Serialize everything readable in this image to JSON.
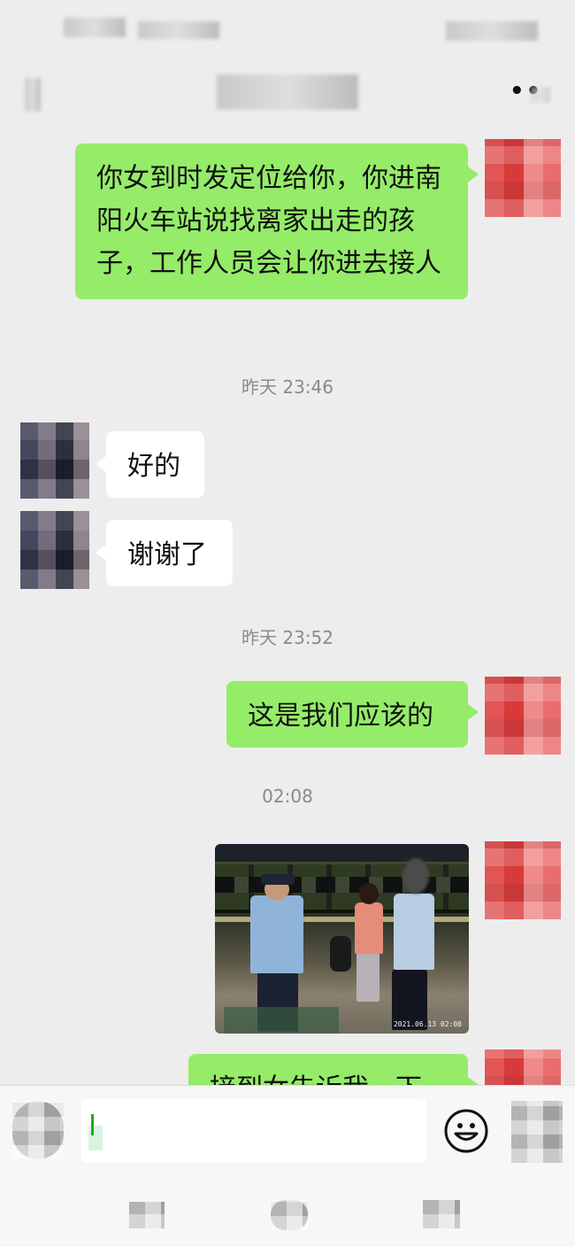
{
  "chat": {
    "messages": [
      {
        "sender": "me",
        "type": "text",
        "text": "你女到时发定位给你，你进南阳火车站说找离家出走的孩子，工作人员会让你进去接人"
      },
      {
        "type": "timestamp",
        "text": "昨天 23:46"
      },
      {
        "sender": "other",
        "type": "text",
        "text": "好的"
      },
      {
        "sender": "other",
        "type": "text",
        "text": "谢谢了"
      },
      {
        "type": "timestamp",
        "text": "昨天 23:52"
      },
      {
        "sender": "me",
        "type": "text",
        "text": "这是我们应该的"
      },
      {
        "type": "timestamp",
        "text": "02:08"
      },
      {
        "sender": "me",
        "type": "image",
        "stamp": "2021.06.13 02:08"
      },
      {
        "sender": "me",
        "type": "text",
        "text": "接到女告诉我一下"
      }
    ]
  },
  "header": {
    "more_icon": "more-dots-icon"
  },
  "input_bar": {
    "voice_icon": "voice-icon",
    "emoji_icon": "smiley-emoji-icon",
    "plus_icon": "plus-icon",
    "input_value": ""
  },
  "colors": {
    "my_bubble": "#95ec69",
    "other_bubble": "#ffffff",
    "background": "#ededed"
  }
}
